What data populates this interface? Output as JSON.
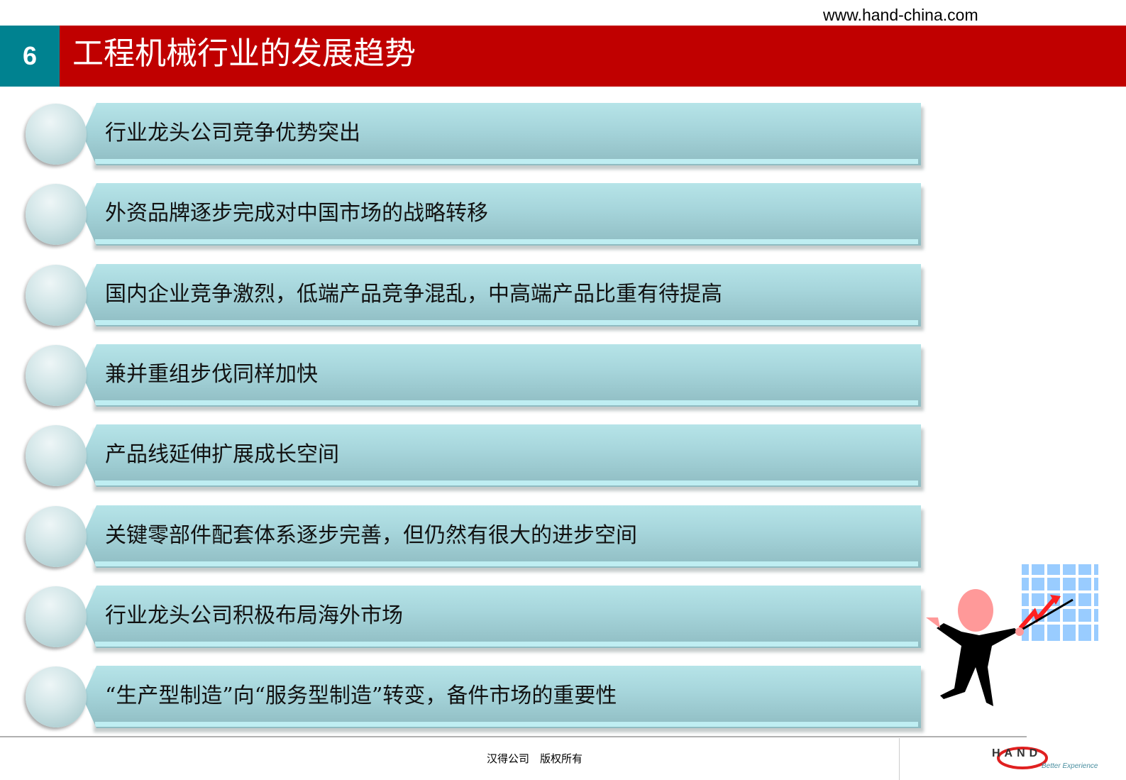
{
  "website": "www.hand-china.com",
  "header": {
    "slide_number": "6",
    "title": "工程机械行业的发展趋势",
    "accent": "#c00000",
    "number_bg": "#008290"
  },
  "items": [
    {
      "label": "行业龙头公司竞争优势突出"
    },
    {
      "label": "外资品牌逐步完成对中国市场的战略转移"
    },
    {
      "label": "国内企业竞争激烈，低端产品竞争混乱，中高端产品比重有待提高"
    },
    {
      "label": "兼并重组步伐同样加快"
    },
    {
      "label": "产品线延伸扩展成长空间"
    },
    {
      "label": "关键零部件配套体系逐步完善，但仍然有很大的进步空间"
    },
    {
      "label": "行业龙头公司积极布局海外市场"
    },
    {
      "label": "“生产型制造”向“服务型制造”转变，备件市场的重要性"
    }
  ],
  "footer": {
    "copyright": "汉得公司　版权所有"
  },
  "logo": {
    "text": "HAND",
    "tagline": "Better Experience"
  }
}
